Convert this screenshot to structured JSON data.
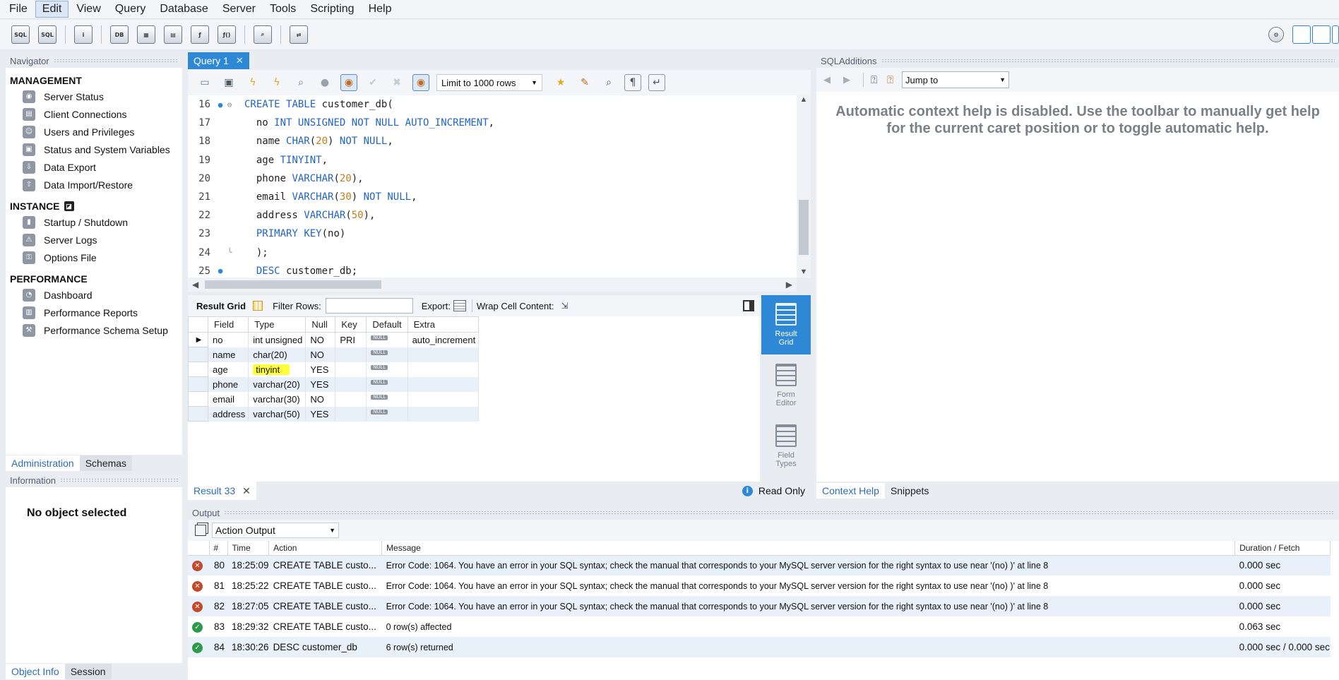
{
  "menu": [
    "File",
    "Edit",
    "View",
    "Query",
    "Database",
    "Server",
    "Tools",
    "Scripting",
    "Help"
  ],
  "navigator": {
    "title": "Navigator",
    "sections": [
      {
        "label": "MANAGEMENT",
        "items": [
          "Server Status",
          "Client Connections",
          "Users and Privileges",
          "Status and System Variables",
          "Data Export",
          "Data Import/Restore"
        ]
      },
      {
        "label": "INSTANCE",
        "items": [
          "Startup / Shutdown",
          "Server Logs",
          "Options File"
        ]
      },
      {
        "label": "PERFORMANCE",
        "items": [
          "Dashboard",
          "Performance Reports",
          "Performance Schema Setup"
        ]
      }
    ],
    "tabs": [
      "Administration",
      "Schemas"
    ]
  },
  "information": {
    "title": "Information",
    "message": "No object selected",
    "tabs": [
      "Object Info",
      "Session"
    ]
  },
  "editor": {
    "tab_label": "Query 1",
    "limit_label": "Limit to 1000 rows",
    "lines": [
      {
        "n": "16",
        "marker": "●",
        "fold": "⊖",
        "code": "CREATE TABLE customer_db("
      },
      {
        "n": "17",
        "code": "  no INT UNSIGNED NOT NULL AUTO_INCREMENT,"
      },
      {
        "n": "18",
        "code": "  name CHAR(20) NOT NULL,"
      },
      {
        "n": "19",
        "code": "  age TINYINT,"
      },
      {
        "n": "20",
        "code": "  phone VARCHAR(20),"
      },
      {
        "n": "21",
        "code": "  email VARCHAR(30) NOT NULL,"
      },
      {
        "n": "22",
        "code": "  address VARCHAR(50),"
      },
      {
        "n": "23",
        "code": "  PRIMARY KEY(no)"
      },
      {
        "n": "24",
        "fold": "╰",
        "code": "  );"
      },
      {
        "n": "25",
        "marker": "●",
        "code": "  DESC customer_db;"
      }
    ]
  },
  "result": {
    "toolbar": {
      "grid_label": "Result Grid",
      "filter_label": "Filter Rows:",
      "export_label": "Export:",
      "wrap_label": "Wrap Cell Content:"
    },
    "columns": [
      "Field",
      "Type",
      "Null",
      "Key",
      "Default",
      "Extra"
    ],
    "rows": [
      [
        "no",
        "int unsigned",
        "NO",
        "PRI",
        "NULL",
        "auto_increment"
      ],
      [
        "name",
        "char(20)",
        "NO",
        "",
        "NULL",
        ""
      ],
      [
        "age",
        "tinyint",
        "YES",
        "",
        "NULL",
        ""
      ],
      [
        "phone",
        "varchar(20)",
        "YES",
        "",
        "NULL",
        ""
      ],
      [
        "email",
        "varchar(30)",
        "NO",
        "",
        "NULL",
        ""
      ],
      [
        "address",
        "varchar(50)",
        "YES",
        "",
        "NULL",
        ""
      ]
    ],
    "highlight_color": "#ffff3a",
    "side_tools": [
      "Result Grid",
      "Form Editor",
      "Field Types"
    ],
    "tab_label": "Result 33",
    "read_only": "Read Only"
  },
  "sql_additions": {
    "title": "SQLAdditions",
    "jump_to": "Jump to",
    "help_text": "Automatic context help is disabled. Use the toolbar to manually get help for the current caret position or to toggle automatic help.",
    "tabs": [
      "Context Help",
      "Snippets"
    ]
  },
  "output": {
    "title": "Output",
    "select": "Action Output",
    "columns": [
      "#",
      "Time",
      "Action",
      "Message",
      "Duration / Fetch"
    ],
    "rows": [
      {
        "status": "error",
        "n": "80",
        "time": "18:25:09",
        "action": "CREATE TABLE custo...",
        "message": "Error Code: 1064. You have an error in your SQL syntax; check the manual that corresponds to your MySQL server version for the right syntax to use near '(no)   )' at line 8",
        "duration": "0.000 sec"
      },
      {
        "status": "error",
        "n": "81",
        "time": "18:25:22",
        "action": "CREATE TABLE custo...",
        "message": "Error Code: 1064. You have an error in your SQL syntax; check the manual that corresponds to your MySQL server version for the right syntax to use near '(no)   )' at line 8",
        "duration": "0.000 sec"
      },
      {
        "status": "error",
        "n": "82",
        "time": "18:27:05",
        "action": "CREATE TABLE custo...",
        "message": "Error Code: 1064. You have an error in your SQL syntax; check the manual that corresponds to your MySQL server version for the right syntax to use near '(no)   )' at line 8",
        "duration": "0.000 sec"
      },
      {
        "status": "ok",
        "n": "83",
        "time": "18:29:32",
        "action": "CREATE TABLE custo...",
        "message": "0 row(s) affected",
        "duration": "0.063 sec"
      },
      {
        "status": "ok",
        "n": "84",
        "time": "18:30:26",
        "action": "DESC customer_db",
        "message": "6 row(s) returned",
        "duration": "0.000 sec / 0.000 sec"
      }
    ]
  }
}
